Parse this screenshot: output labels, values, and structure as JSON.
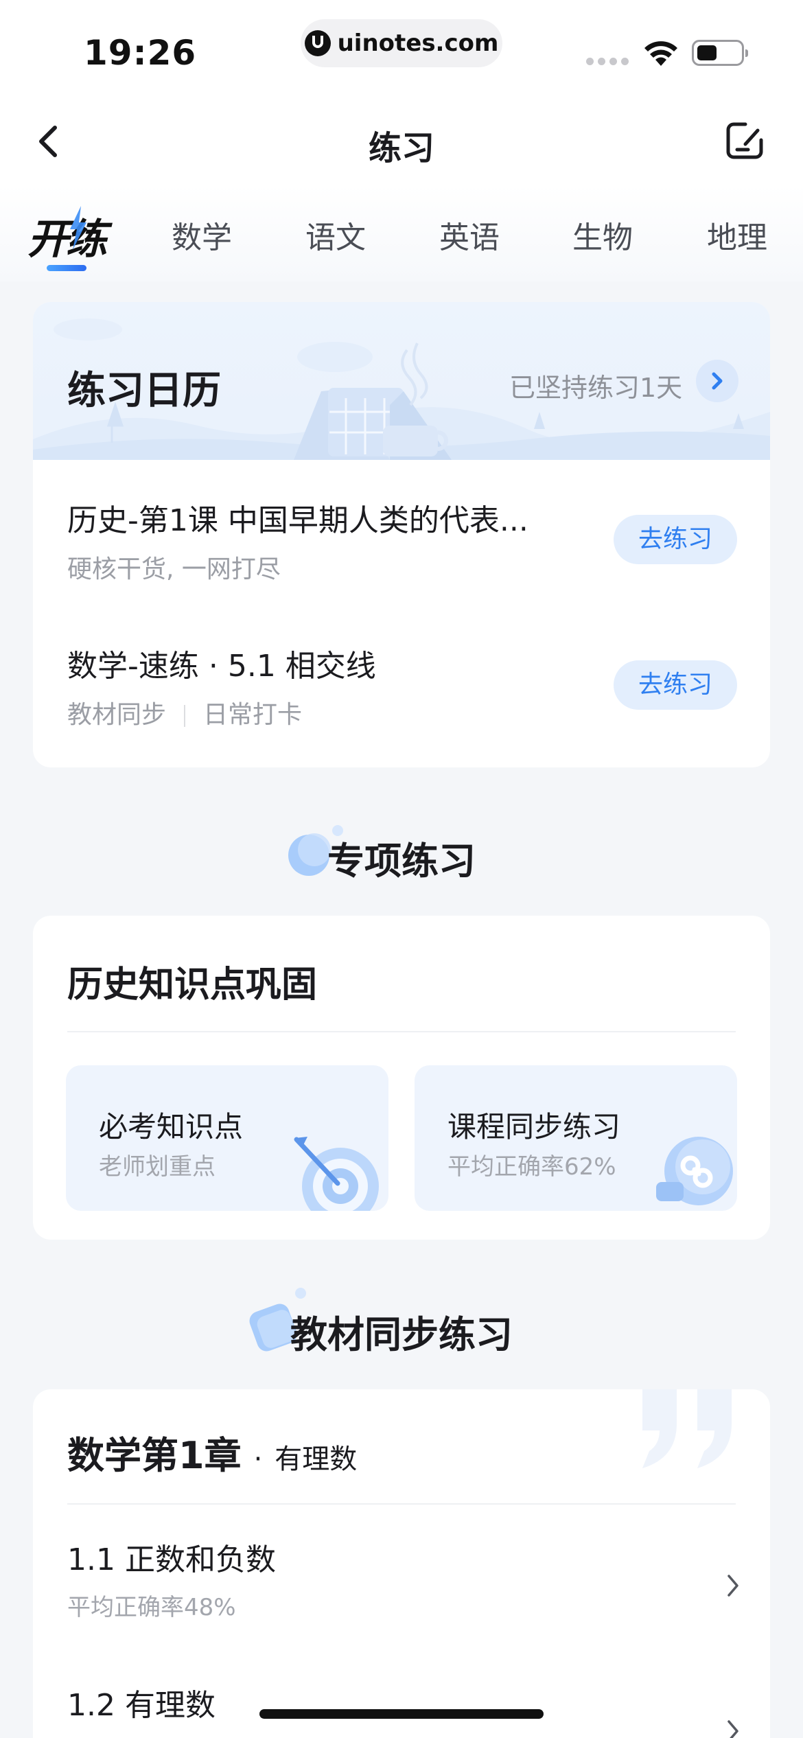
{
  "status_bar": {
    "time": "19:26",
    "url": "uinotes.com"
  },
  "nav": {
    "title": "练习",
    "back_icon": "chevron-left-icon",
    "edit_icon": "edit-square-icon"
  },
  "tabs": {
    "active": "开练",
    "items": [
      "数学",
      "语文",
      "英语",
      "生物",
      "地理"
    ]
  },
  "calendar": {
    "title": "练习日历",
    "streak": "已坚持练习1天",
    "items": [
      {
        "title": "历史-第1课 中国早期人类的代表...",
        "subtitle": "硬核干货, 一网打尽",
        "button": "去练习"
      },
      {
        "title": "数学-速练 · 5.1 相交线",
        "tags": [
          "教材同步",
          "日常打卡"
        ],
        "button": "去练习"
      }
    ]
  },
  "special": {
    "section_title": "专项练习",
    "card_title": "历史知识点巩固",
    "tiles": [
      {
        "title": "必考知识点",
        "subtitle": "老师划重点",
        "icon": "target-icon"
      },
      {
        "title": "课程同步练习",
        "subtitle": "平均正确率62%",
        "icon": "link-icon"
      }
    ]
  },
  "textbook": {
    "section_title": "教材同步练习",
    "chapter_title": "数学第1章",
    "chapter_dot": "·",
    "chapter_sub": "有理数",
    "lessons": [
      {
        "title": "1.1 正数和负数",
        "subtitle": "平均正确率48%"
      },
      {
        "title": "1.2 有理数",
        "subtitle": ""
      }
    ]
  },
  "colors": {
    "accent": "#2f7ff0",
    "button_bg": "#e3eefd",
    "page_bg": "#f4f6f9"
  }
}
